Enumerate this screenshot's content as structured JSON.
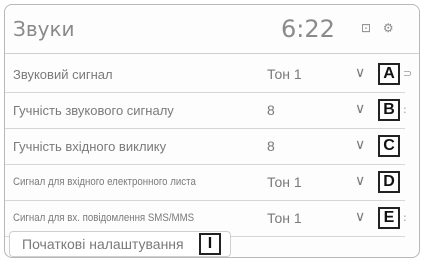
{
  "header": {
    "title": "Звуки",
    "clock": "6:22",
    "status_icons": [
      "lock-icon",
      "gear-icon"
    ],
    "status_glyphs": "⊡ ⚙"
  },
  "settings": {
    "rows": [
      {
        "label": "Звуковий сигнал",
        "value": "Тон 1",
        "chevron": "∨",
        "tag": "A",
        "side": "⊃"
      },
      {
        "label": "Гучність звукового сигналу",
        "value": "8",
        "chevron": "∨",
        "tag": "B",
        "side": ":"
      },
      {
        "label": "Гучність вхідного виклику",
        "value": "8",
        "chevron": "∨",
        "tag": "C",
        "side": ""
      },
      {
        "label": "Сигнал для вхідного електронного листа",
        "value": "Тон 1",
        "chevron": "∨",
        "tag": "D",
        "side": ""
      },
      {
        "label": "Сигнал для вх. повідомлення SMS/MMS",
        "value": "Тон 1",
        "chevron": "∨",
        "tag": "E",
        "side": ":"
      }
    ]
  },
  "reset": {
    "label": "Початкові налаштування",
    "tag": "I"
  }
}
